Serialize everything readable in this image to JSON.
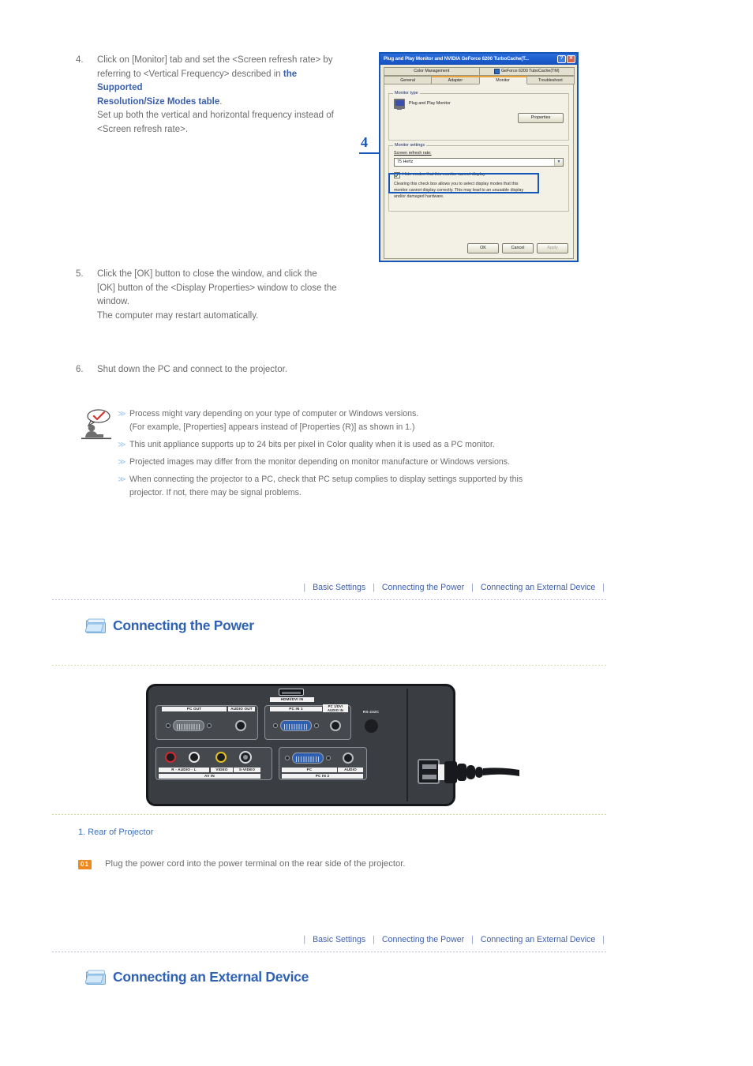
{
  "steps": [
    {
      "num": "4.",
      "lines": [
        {
          "t": "Click on [Monitor] tab and set the <Screen refresh rate> by"
        },
        {
          "t": "referring to <Vertical Frequency> described in "
        },
        {
          "t": "the Supported",
          "link": true
        },
        {
          "t": "Resolution/Size Modes table",
          "link": true
        },
        {
          "t": "Set up both the vertical and horizontal frequency instead of"
        },
        {
          "t": "<Screen refresh rate>."
        }
      ]
    },
    {
      "num": "5.",
      "lines": [
        "Click the [OK] button to close the window, and click the",
        "[OK] button of the <Display Properties> window to close the",
        "window.",
        "The computer may restart automatically."
      ]
    },
    {
      "num": "6.",
      "lines": [
        "Shut down the PC and connect to the projector."
      ]
    }
  ],
  "dialog": {
    "title": "Plug and Play Monitor and NVIDIA GeForce 6200 TurboCache(T...",
    "help_button": "?",
    "close_button": "✕",
    "tabs_row1": [
      "Color Management",
      "GeForce 6200 TuboCache(TM)"
    ],
    "tabs_row2": [
      "General",
      "Adapter",
      "Monitor",
      "Troubleshoot"
    ],
    "active_tab": "Monitor",
    "monitor_type_legend": "Monitor type",
    "monitor_type_value": "Plug and Play Monitor",
    "properties_button": "Properties",
    "monitor_settings_legend": "Monitor settings",
    "refresh_rate_label": "Screen refresh rate:",
    "refresh_rate_value": "75 Hertz",
    "dropdown_arrow": "▼",
    "hide_modes_label": "Hide modes that this monitor cannot display",
    "hide_modes_checked": true,
    "hide_modes_desc_line1": "Clearing this check box allows you to select display modes that this",
    "hide_modes_desc_line2": "monitor cannot display correctly. This may lead to an unusable display",
    "hide_modes_desc_line3": "and/or damaged hardware.",
    "ok_button": "OK",
    "cancel_button": "Cancel",
    "apply_button": "Apply",
    "callout": "4",
    "highlight_color": "#1556b8"
  },
  "notes": {
    "icon": "note-person-icon",
    "bullet": "≫",
    "items": [
      "Process might vary depending on your type of computer or Windows versions.\n(For example, [Properties] appears instead of [Properties (R)] as shown in 1.)",
      "This unit appliance supports up to 24 bits per pixel in Color quality when it is used as a PC monitor.",
      "Projected images may differ from the monitor depending on monitor manufacture or Windows versions.",
      "When connecting the projector to a PC, check that PC setup complies to display settings supported by this\nprojector. If not, there may be signal problems."
    ]
  },
  "nav": {
    "separator": "|",
    "links": [
      "Basic Settings",
      "Connecting the Power",
      "Connecting an External Device"
    ]
  },
  "section_power": {
    "icon": "folder-icon",
    "title": "Connecting the Power"
  },
  "section_external": {
    "icon": "folder-icon",
    "title": "Connecting an External Device"
  },
  "projector": {
    "caption": "1. Rear of Projector",
    "instruction_badge": "01",
    "instruction_text": "Plug the power cord into the power terminal on the rear side of the projector.",
    "ports": {
      "pc_out": "PC OUT",
      "audio_out": "AUDIO OUT",
      "hdmi": "HDMI/DVI IN",
      "pc_in_1": "PC IN 1",
      "pc1_dvi_audio_in": "PC 1/DVI\nAUDIO IN",
      "rs232c": "RS-232C",
      "av_audio": "R  - AUDIO -  L",
      "video": "VIDEO",
      "svideo": "S-VIDEO",
      "av_in": "AV IN",
      "pc": "PC",
      "audio": "AUDIO",
      "pc_in_2": "PC IN 2"
    }
  },
  "colors": {
    "link": "#3d5fb0",
    "heading": "#2f62b5",
    "badge": "#f08a1e",
    "body_text": "#6c6c6e",
    "dialog_highlight": "#1556b8"
  }
}
